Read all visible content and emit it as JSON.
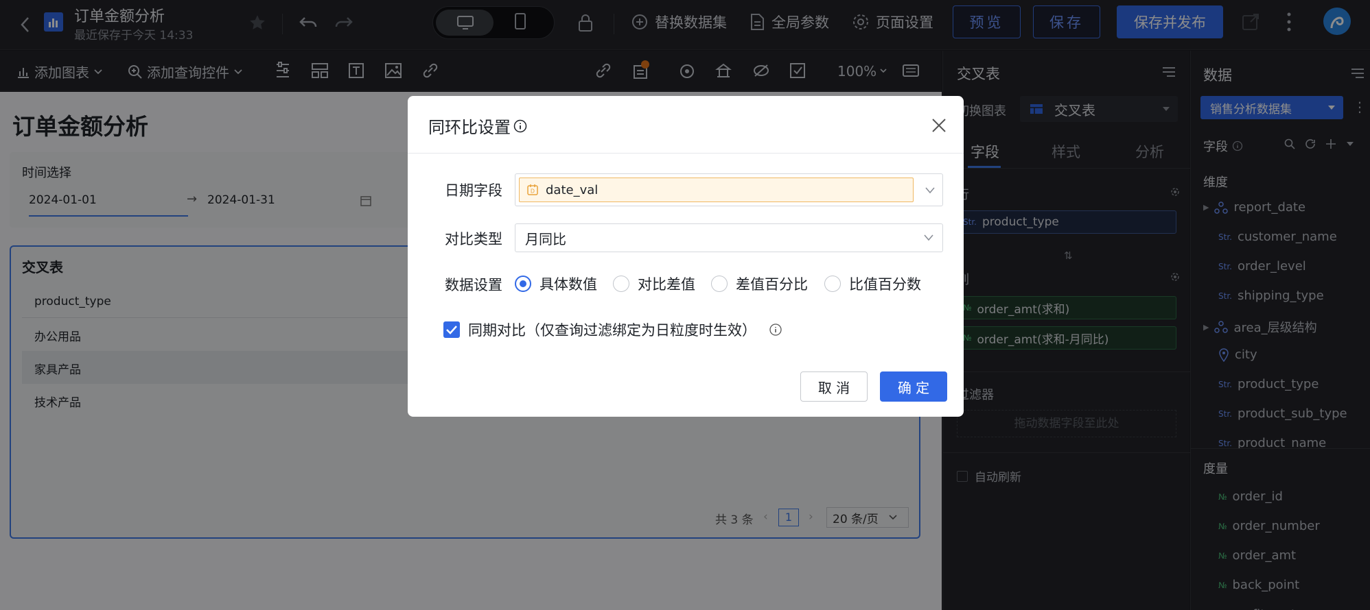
{
  "header": {
    "title": "订单金额分析",
    "subtitle": "最近保存于今天 14:33",
    "replace_dataset": "替换数据集",
    "global_params": "全局参数",
    "page_settings": "页面设置",
    "preview": "预览",
    "save": "保存",
    "save_publish": "保存并发布"
  },
  "toolbar": {
    "add_chart": "添加图表",
    "add_query": "添加查询控件",
    "zoom": "100%"
  },
  "canvas": {
    "title": "订单金额分析",
    "filter_label": "时间选择",
    "date_start": "2024-01-01",
    "date_end": "2024-01-31",
    "table_title": "交叉表",
    "column_header": "product_type",
    "rows": [
      "办公用品",
      "家具产品",
      "技术产品"
    ],
    "total": "共 3 条",
    "page": "1",
    "page_size": "20 条/页"
  },
  "panel_chart": {
    "title": "交叉表",
    "switch_label": "切换图表",
    "chart_type": "交叉表",
    "tabs": [
      "字段",
      "样式",
      "分析"
    ],
    "row_label": "行",
    "row_field": "product_type",
    "col_label": "列",
    "col_fields": [
      "order_amt(求和)",
      "order_amt(求和-月同比)"
    ],
    "filter_label": "过滤器",
    "filter_placeholder": "拖动数据字段至此处",
    "auto_refresh": "自动刷新"
  },
  "panel_data": {
    "title": "数据",
    "dataset": "销售分析数据集",
    "fields_label": "字段",
    "dimension_label": "维度",
    "dimensions": [
      "report_date",
      "customer_name",
      "order_level",
      "shipping_type",
      "area_层级结构",
      "city",
      "product_type",
      "product_sub_type",
      "product_name"
    ],
    "measure_label": "度量",
    "measures": [
      "order_id",
      "order_number",
      "order_amt",
      "back_point",
      "profit_amt"
    ]
  },
  "modal": {
    "title": "同环比设置",
    "date_field_label": "日期字段",
    "date_field_value": "date_val",
    "compare_type_label": "对比类型",
    "compare_type_value": "月同比",
    "data_setting_label": "数据设置",
    "options": [
      "具体数值",
      "对比差值",
      "差值百分比",
      "比值百分数"
    ],
    "selected_option": "具体数值",
    "checkbox_label": "同期对比（仅查询过滤绑定为日粒度时生效）",
    "checkbox_checked": true,
    "cancel": "取 消",
    "confirm": "确 定"
  },
  "colors": {
    "accent": "#3269e6",
    "dimension_chip": "#1f2a44",
    "measure_chip": "#1f3a2a",
    "date_field_bg": "#fff6e6"
  }
}
